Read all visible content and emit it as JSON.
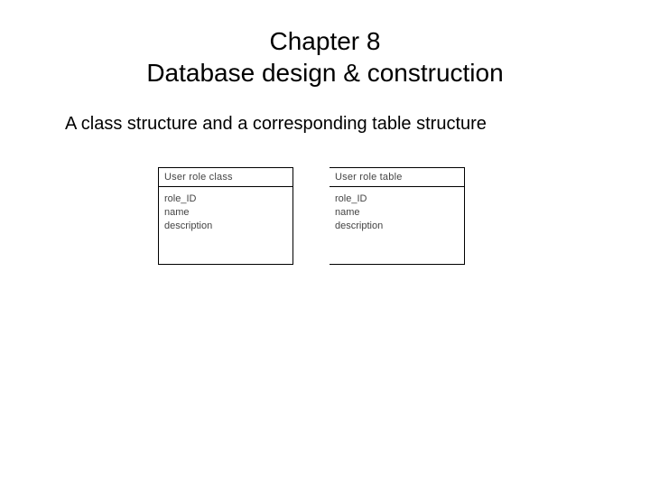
{
  "chapter_number": "Chapter 8",
  "chapter_title": "Database design & construction",
  "subtitle": "A class structure and a corresponding table structure",
  "classBox": {
    "header": "User role class",
    "attrs": [
      "role_ID",
      "name",
      "description"
    ]
  },
  "tableBox": {
    "header": "User role table",
    "attrs": [
      "role_ID",
      "name",
      "description"
    ]
  }
}
